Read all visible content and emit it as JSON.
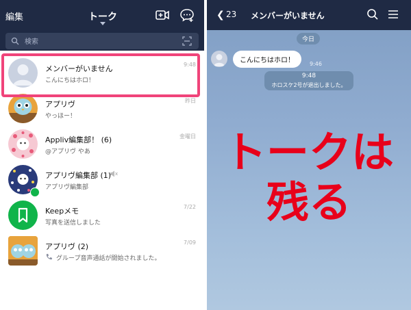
{
  "left": {
    "header": {
      "edit_label": "編集",
      "title": "トーク",
      "search_placeholder": "検索"
    },
    "chats": [
      {
        "name": "メンバーがいません",
        "preview": "こんにちはホロ！",
        "time": "9:48",
        "avatar": "default-person"
      },
      {
        "name": "アプリヴ",
        "preview": "やっほー！",
        "time": "昨日",
        "avatar": "owl-character"
      },
      {
        "name": "Appliv編集部！ (6)",
        "preview": "@アプリヴ やあ",
        "time": "金曜日",
        "avatar": "pink-pattern"
      },
      {
        "name": "アプリヴ編集部 (1)",
        "preview": "アプリヴ編集部",
        "time": "",
        "avatar": "blue-pattern"
      },
      {
        "name": "Keepメモ",
        "preview": "写真を送信しました",
        "time": "7/22",
        "avatar": "bookmark-green"
      },
      {
        "name": "アプリヴ (2)",
        "preview": "グループ音声通話が開始されました。",
        "time": "7/09",
        "avatar": "owl-group"
      }
    ]
  },
  "right": {
    "header": {
      "back_count": "23",
      "title": "メンバーがいません"
    },
    "date_label": "今日",
    "message": {
      "text": "こんにちはホロ！",
      "time": "9:46"
    },
    "system": {
      "time": "9:48",
      "text": "ホロスケ2号が退出しました。"
    },
    "overlay_line1": "トークは",
    "overlay_line2": "残る"
  },
  "colors": {
    "header_bg": "#1f2a44",
    "highlight": "#f0447a",
    "overlay_text": "#e8001a",
    "keep_green": "#10b44a"
  }
}
